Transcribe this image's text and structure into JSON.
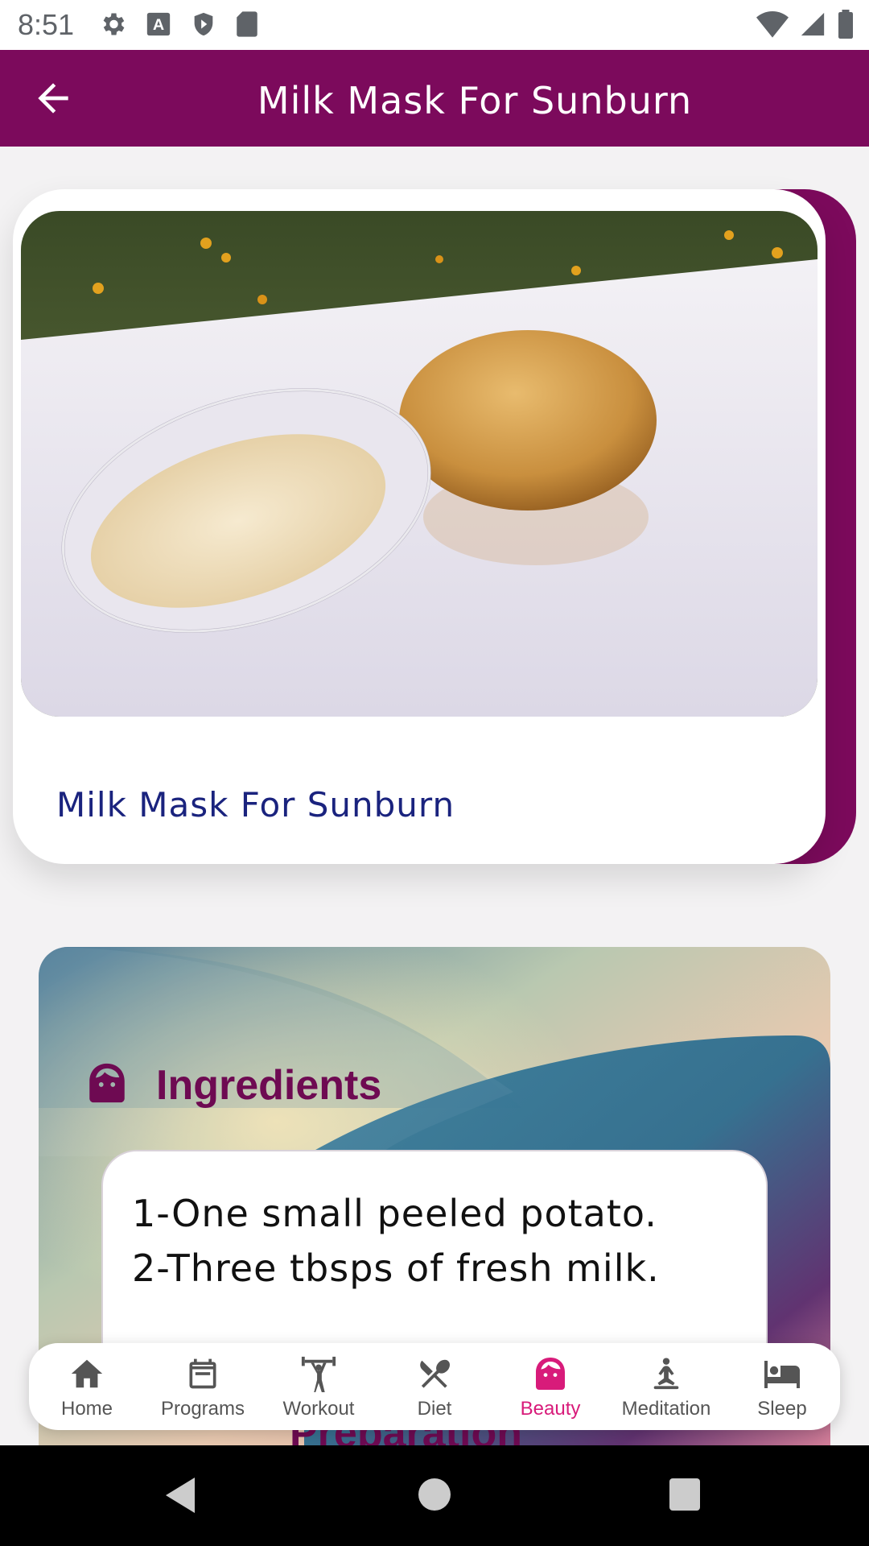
{
  "status_bar": {
    "time": "8:51",
    "left_icons": [
      "gear-icon",
      "a-icon",
      "shield-icon",
      "sdcard-icon"
    ],
    "right_icons": [
      "wifi-icon",
      "signal-icon",
      "battery-icon"
    ]
  },
  "app_bar": {
    "title": "Milk Mask For Sunburn",
    "back_icon": "arrow-left-icon"
  },
  "card": {
    "title": "Milk Mask For Sunburn",
    "image_desc": "glass-bowl-and-potato"
  },
  "ingredients": {
    "title": "Ingredients",
    "icon": "face-icon",
    "lines": [
      "1-One small peeled potato.",
      "2-Three tbsps of fresh milk."
    ]
  },
  "preparation": {
    "title": "Preparation"
  },
  "bottom_nav": {
    "items": [
      {
        "label": "Home",
        "icon": "home-icon"
      },
      {
        "label": "Programs",
        "icon": "calendar-icon"
      },
      {
        "label": "Workout",
        "icon": "weightlifter-icon"
      },
      {
        "label": "Diet",
        "icon": "fork-knife-icon"
      },
      {
        "label": "Beauty",
        "icon": "face-icon",
        "active": true
      },
      {
        "label": "Meditation",
        "icon": "meditation-icon"
      },
      {
        "label": "Sleep",
        "icon": "bed-icon"
      }
    ]
  },
  "colors": {
    "primary": "#7c0a5c",
    "accent": "#d81b7a",
    "card_title": "#1a237e"
  }
}
